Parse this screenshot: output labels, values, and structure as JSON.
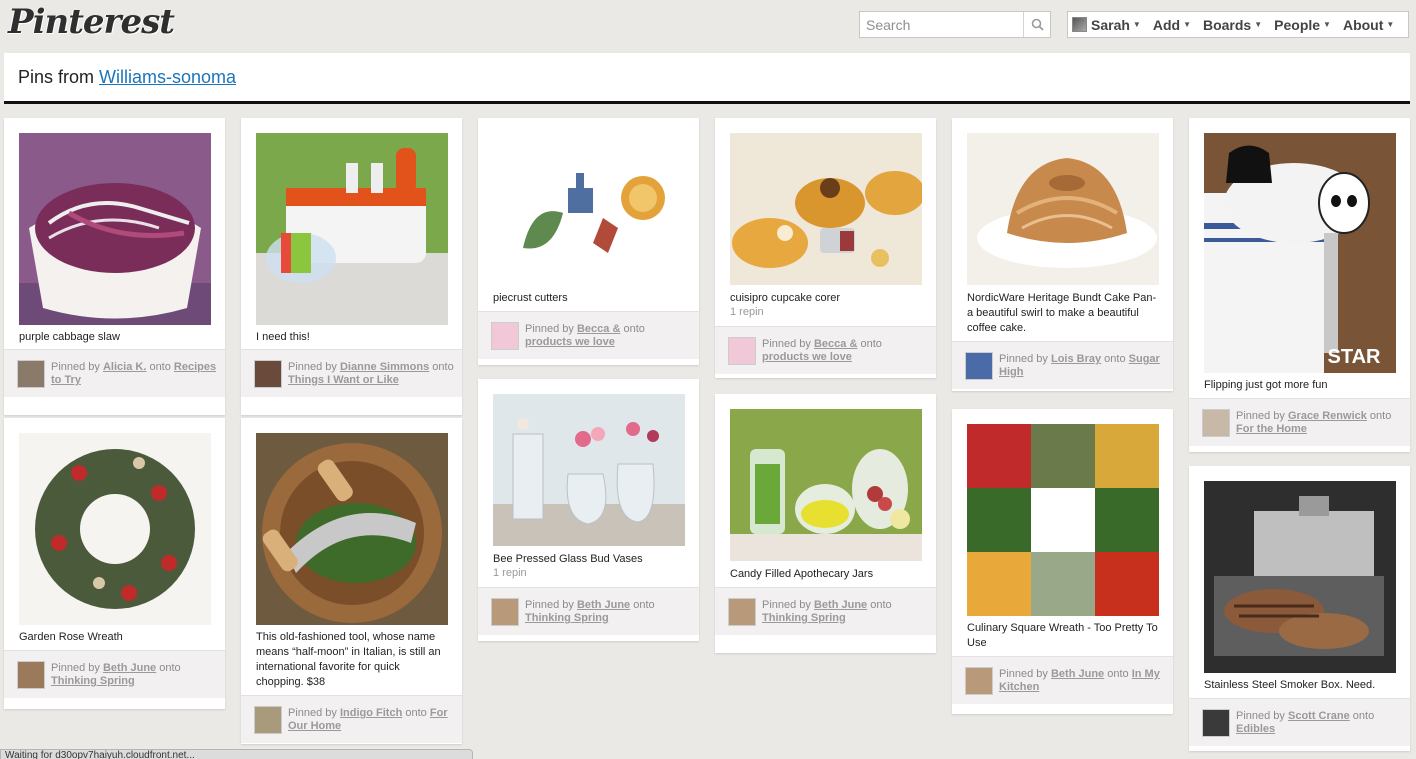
{
  "header": {
    "logo": "Pinterest",
    "search_placeholder": "Search",
    "nav": [
      {
        "label": "Sarah"
      },
      {
        "label": "Add"
      },
      {
        "label": "Boards"
      },
      {
        "label": "People"
      },
      {
        "label": "About"
      }
    ]
  },
  "page": {
    "title_prefix": "Pins from ",
    "title_link": "Williams-sonoma"
  },
  "pins": [
    {
      "desc": "purple cabbage slaw",
      "stats": "",
      "pinned_by": "Alicia K.",
      "board": "Recipes to Try"
    },
    {
      "desc": "I need this!",
      "stats": "",
      "pinned_by": "Dianne Simmons",
      "board": "Things I Want or Like"
    },
    {
      "desc": "piecrust cutters",
      "stats": "",
      "pinned_by": "Becca &",
      "board": "products we love"
    },
    {
      "desc": "cuisipro cupcake corer",
      "stats": "1 repin",
      "pinned_by": "Becca &",
      "board": "products we love"
    },
    {
      "desc": "NordicWare Heritage Bundt Cake Pan- a beautiful swirl to make a beautiful coffee cake.",
      "stats": "",
      "pinned_by": "Lois Bray",
      "board": "Sugar High"
    },
    {
      "desc": "Flipping just got more fun",
      "stats": "",
      "pinned_by": "Grace Renwick",
      "board": "For the Home"
    },
    {
      "desc": "Garden Rose Wreath",
      "stats": "",
      "pinned_by": "Beth June",
      "board": "Thinking Spring"
    },
    {
      "desc": "This old-fashioned tool, whose name means “half-moon” in Italian, is still an international favorite for quick chopping. $38",
      "stats": "",
      "pinned_by": "Indigo Fitch",
      "board": "For Our Home"
    },
    {
      "desc": "Bee Pressed Glass Bud Vases",
      "stats": "1 repin",
      "pinned_by": "Beth June",
      "board": "Thinking Spring"
    },
    {
      "desc": "Candy Filled Apothecary Jars",
      "stats": "",
      "pinned_by": "Beth June",
      "board": "Thinking Spring"
    },
    {
      "desc": "Culinary Square Wreath - Too Pretty To Use",
      "stats": "",
      "pinned_by": "Beth June",
      "board": "In My Kitchen"
    },
    {
      "desc": "Stainless Steel Smoker Box. Need.",
      "stats": "",
      "pinned_by": "Scott Crane",
      "board": "Edibles"
    }
  ],
  "attr_labels": {
    "pinned_by": "Pinned by ",
    "onto": " onto "
  },
  "status_bar": "Waiting for d30opv7haiyuh.cloudfront.net..."
}
